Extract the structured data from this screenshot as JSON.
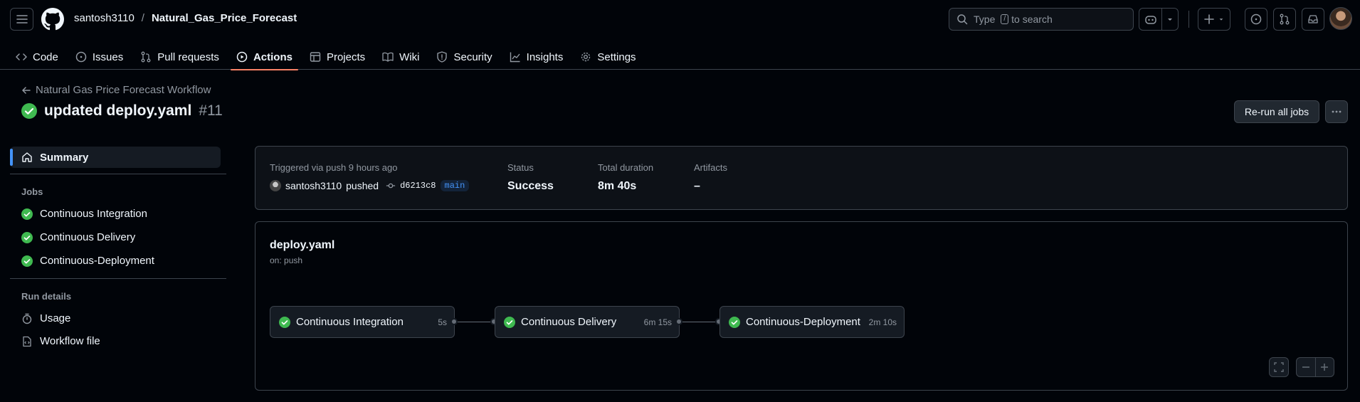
{
  "header": {
    "owner": "santosh3110",
    "separator": "/",
    "repo": "Natural_Gas_Price_Forecast",
    "search_prefix": "Type",
    "search_key": "/",
    "search_suffix": "to search"
  },
  "tabs": [
    {
      "label": "Code",
      "icon": "code-icon"
    },
    {
      "label": "Issues",
      "icon": "issue-icon"
    },
    {
      "label": "Pull requests",
      "icon": "pull-request-icon"
    },
    {
      "label": "Actions",
      "icon": "play-icon",
      "active": true
    },
    {
      "label": "Projects",
      "icon": "table-icon"
    },
    {
      "label": "Wiki",
      "icon": "book-icon"
    },
    {
      "label": "Security",
      "icon": "shield-icon"
    },
    {
      "label": "Insights",
      "icon": "graph-icon"
    },
    {
      "label": "Settings",
      "icon": "gear-icon"
    }
  ],
  "run": {
    "back_label": "Natural Gas Price Forecast Workflow",
    "title": "updated deploy.yaml",
    "number": "#11",
    "rerun_label": "Re-run all jobs"
  },
  "sidebar": {
    "summary_label": "Summary",
    "jobs_heading": "Jobs",
    "jobs": [
      "Continuous Integration",
      "Continuous Delivery",
      "Continuous-Deployment"
    ],
    "run_details_heading": "Run details",
    "usage_label": "Usage",
    "workflow_file_label": "Workflow file"
  },
  "summary": {
    "trigger": "Triggered via push 9 hours ago",
    "actor": "santosh3110",
    "action": "pushed",
    "sha": "d6213c8",
    "branch": "main",
    "status_label": "Status",
    "status_value": "Success",
    "duration_label": "Total duration",
    "duration_value": "8m 40s",
    "artifacts_label": "Artifacts",
    "artifacts_value": "–"
  },
  "graph": {
    "file": "deploy.yaml",
    "on": "on: push",
    "jobs": [
      {
        "name": "Continuous Integration",
        "duration": "5s"
      },
      {
        "name": "Continuous Delivery",
        "duration": "6m 15s"
      },
      {
        "name": "Continuous-Deployment",
        "duration": "2m 10s"
      }
    ]
  },
  "colors": {
    "background": "#010409",
    "success": "#3fb950",
    "accent_underline": "#f78166",
    "link_blue": "#4493f8"
  }
}
